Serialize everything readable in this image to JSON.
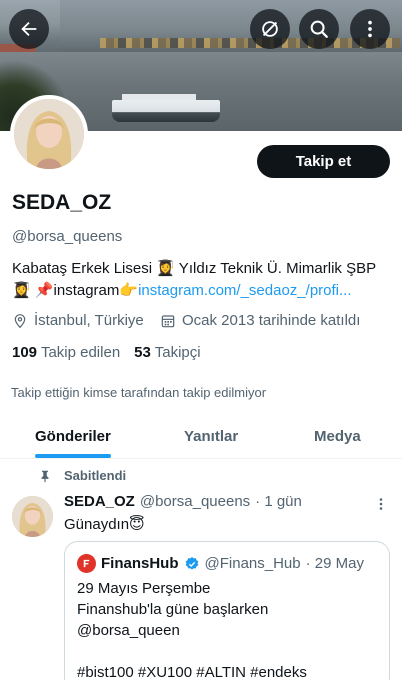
{
  "header": {
    "back_icon": "arrow-left-icon",
    "circle_icon": "circle-slash-icon",
    "search_icon": "search-icon",
    "more_icon": "more-vertical-icon"
  },
  "profile": {
    "follow_label": "Takip et",
    "display_name": "SEDA_OZ",
    "handle": "@borsa_queens",
    "bio_line1": "Kabataş Erkek Lisesi 👩‍🎓 Yıldız Teknik Ü. Mimarlik ŞBP",
    "bio_line2_prefix": "👩‍🎓 📌instagram👉",
    "bio_link": "instagram.com/_sedaoz_/profi...",
    "location": "İstanbul, Türkiye",
    "joined": "Ocak 2013 tarihinde katıldı",
    "following_count": "109",
    "following_label": "Takip edilen",
    "followers_count": "53",
    "followers_label": "Takipçi",
    "not_followed_text": "Takip ettiğin kimse tarafından takip edilmiyor"
  },
  "tabs": [
    {
      "label": "Gönderiler",
      "active": true
    },
    {
      "label": "Yanıtlar",
      "active": false
    },
    {
      "label": "Medya",
      "active": false
    }
  ],
  "pinned_label": "Sabitlendi",
  "tweet": {
    "name": "SEDA_OZ",
    "handle": "@borsa_queens",
    "time": "· 1 gün",
    "text": "Günaydın😇",
    "quote": {
      "name": "FinansHub",
      "handle": "@Finans_Hub",
      "date": "· 29 May",
      "lines": [
        "29 Mayıs Perşembe",
        "Finanshub'la güne başlarken",
        "@borsa_queen",
        "",
        "#bist100 #XU100 #ALTIN  #endeks"
      ]
    }
  },
  "colors": {
    "accent": "#1d9bf0",
    "text": "#0f1419",
    "muted": "#536471"
  }
}
